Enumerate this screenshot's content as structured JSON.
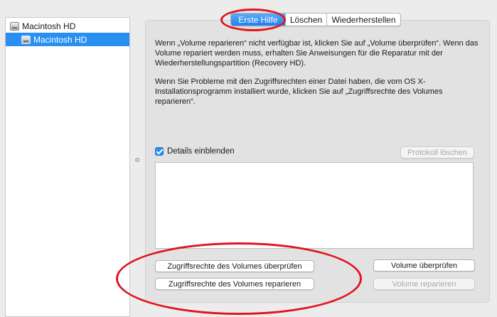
{
  "sidebar": {
    "items": [
      {
        "label": "Macintosh HD",
        "icon": "hard-disk-icon",
        "selected": false
      },
      {
        "label": "Macintosh HD",
        "icon": "hard-disk-icon",
        "selected": true
      }
    ]
  },
  "tabs": [
    {
      "label": "Erste Hilfe",
      "active": true
    },
    {
      "label": "Löschen",
      "active": false
    },
    {
      "label": "Wiederherstellen",
      "active": false
    }
  ],
  "info": {
    "paragraph1": "Wenn „Volume reparieren“ nicht verfügbar ist, klicken Sie auf „Volume überprüfen“. Wenn das Volume repariert werden muss, erhalten Sie Anweisungen für die Reparatur mit der Wiederherstellungspartition (Recovery HD).",
    "paragraph2": "Wenn Sie Probleme mit den Zugriffsrechten einer Datei haben, die vom OS X-Installationsprogramm installiert wurde, klicken Sie auf „Zugriffsrechte des Volumes reparieren“."
  },
  "details": {
    "label": "Details einblenden",
    "checked": true
  },
  "buttons": {
    "clear_log": "Protokoll löschen",
    "verify_permissions": "Zugriffsrechte des Volumes überprüfen",
    "repair_permissions": "Zugriffsrechte des Volumes reparieren",
    "verify_volume": "Volume überprüfen",
    "repair_volume": "Volume reparieren"
  },
  "colors": {
    "accent": "#2a8ff2",
    "annotation": "#e0141e"
  }
}
